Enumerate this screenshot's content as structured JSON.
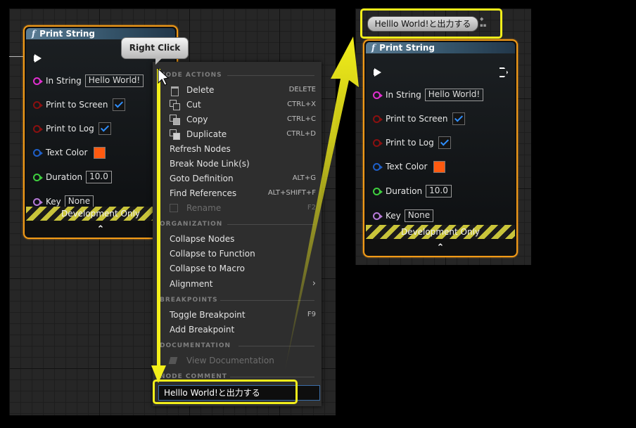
{
  "node": {
    "title": "Print String",
    "func_glyph": "f",
    "in_string_label": "In String",
    "in_string_value": "Hello World!",
    "print_screen_label": "Print to Screen",
    "print_log_label": "Print to Log",
    "text_color_label": "Text Color",
    "duration_label": "Duration",
    "duration_value": "10.0",
    "key_label": "Key",
    "key_value": "None",
    "dev_only_label": "Development Only",
    "expand_glyph": "⌃"
  },
  "callout": {
    "right_click": "Right Click"
  },
  "menu": {
    "node_actions": "NODE ACTIONS",
    "delete": "Delete",
    "delete_sc": "DELETE",
    "cut": "Cut",
    "cut_sc": "CTRL+X",
    "copy": "Copy",
    "copy_sc": "CTRL+C",
    "duplicate": "Duplicate",
    "duplicate_sc": "CTRL+D",
    "refresh": "Refresh Nodes",
    "break_links": "Break Node Link(s)",
    "goto_def": "Goto Definition",
    "goto_def_sc": "ALT+G",
    "find_refs": "Find References",
    "find_refs_sc": "ALT+SHIFT+F",
    "rename": "Rename",
    "rename_sc": "F2",
    "organization": "ORGANIZATION",
    "collapse_nodes": "Collapse Nodes",
    "collapse_func": "Collapse to Function",
    "collapse_macro": "Collapse to Macro",
    "alignment": "Alignment",
    "breakpoints": "BREAKPOINTS",
    "toggle_bp": "Toggle Breakpoint",
    "toggle_bp_sc": "F9",
    "add_bp": "Add Breakpoint",
    "documentation": "DOCUMENTATION",
    "view_doc": "View Documentation",
    "node_comment": "NODE COMMENT",
    "comment_value": "Helllo World!と出力する"
  },
  "comment_bubble": "Helllo World!と出力する",
  "colors": {
    "highlight": "#f2ee1a",
    "node_border": "#f29a17",
    "text_color_swatch": "#ff5a10"
  }
}
